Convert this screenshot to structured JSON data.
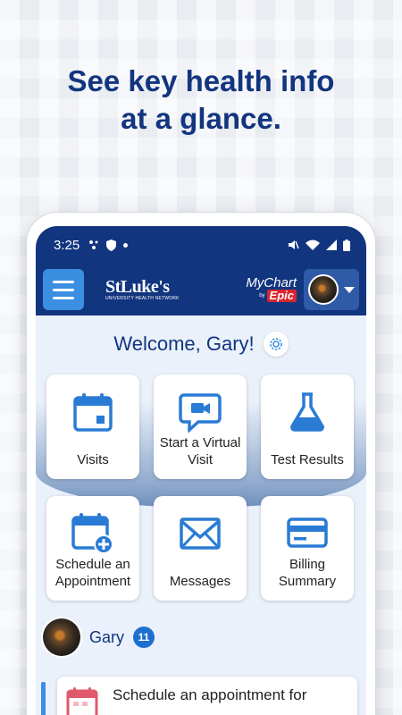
{
  "headline": {
    "line1": "See key health info",
    "line2": "at a glance."
  },
  "status_bar": {
    "time": "3:25"
  },
  "app_bar": {
    "brand": "StLuke's",
    "brand_sub": "UNIVERSITY HEALTH NETWORK",
    "mychart_label": "MyChart",
    "by_label": "by",
    "epic_label": "Epic"
  },
  "welcome": {
    "text": "Welcome, Gary!"
  },
  "tiles": [
    {
      "label": "Visits",
      "icon": "calendar-icon"
    },
    {
      "label": "Start a Virtual Visit",
      "icon": "video-chat-icon"
    },
    {
      "label": "Test Results",
      "icon": "flask-icon"
    },
    {
      "label": "Schedule an Appointment",
      "icon": "calendar-add-icon"
    },
    {
      "label": "Messages",
      "icon": "envelope-icon"
    },
    {
      "label": "Billing Summary",
      "icon": "credit-card-icon"
    }
  ],
  "patient": {
    "name": "Gary",
    "count": "11"
  },
  "todo": {
    "text": "Schedule an appointment for"
  },
  "colors": {
    "brand_navy": "#12357f",
    "accent_blue": "#3b8ee0",
    "epic_red": "#d8262e"
  }
}
